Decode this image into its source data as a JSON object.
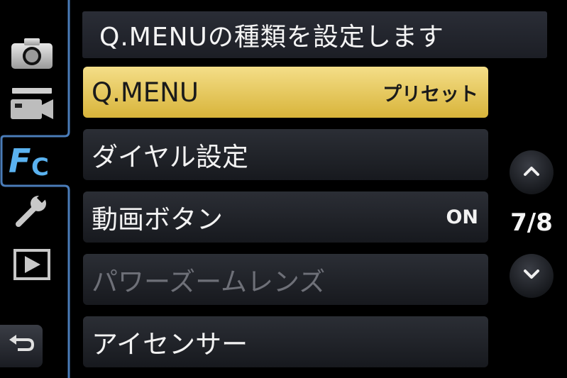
{
  "header": {
    "title": "Q.MENUの種類を設定します"
  },
  "menu": [
    {
      "label": "Q.MENU",
      "value": "プリセット",
      "state": "selected"
    },
    {
      "label": "ダイヤル設定",
      "value": "",
      "state": "normal"
    },
    {
      "label": "動画ボタン",
      "value": "ON",
      "state": "normal"
    },
    {
      "label": "パワーズームレンズ",
      "value": "",
      "state": "disabled"
    },
    {
      "label": "アイセンサー",
      "value": "",
      "state": "normal"
    }
  ],
  "pagination": {
    "indicator": "7/8"
  },
  "tabs": [
    {
      "icon": "camera-icon"
    },
    {
      "icon": "movie-camera-icon"
    },
    {
      "icon": "custom-fc-icon",
      "active": true
    },
    {
      "icon": "wrench-icon"
    },
    {
      "icon": "playback-icon"
    }
  ],
  "colors": {
    "accent": "#e7c85a",
    "frame": "#4a7cb8",
    "disabled_text": "#6e7078"
  }
}
